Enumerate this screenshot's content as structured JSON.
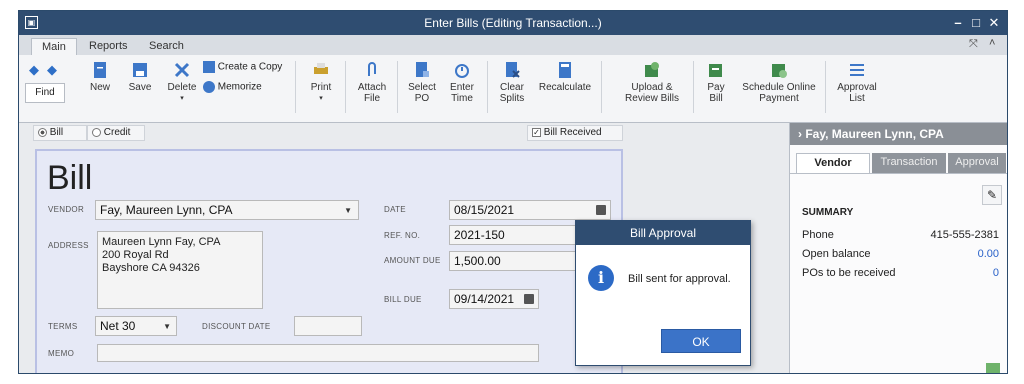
{
  "window": {
    "title": "Enter Bills (Editing Transaction...)"
  },
  "tabs": [
    "Main",
    "Reports",
    "Search"
  ],
  "toolbar": {
    "find": "Find",
    "new": "New",
    "save": "Save",
    "delete": "Delete",
    "create_copy": "Create a Copy",
    "memorize": "Memorize",
    "print": "Print",
    "attach_file": [
      "Attach",
      "File"
    ],
    "select_po": [
      "Select",
      "PO"
    ],
    "enter_time": [
      "Enter",
      "Time"
    ],
    "clear_splits": [
      "Clear",
      "Splits"
    ],
    "recalculate": "Recalculate",
    "upload_review": [
      "Upload &",
      "Review Bills"
    ],
    "pay_bill": [
      "Pay",
      "Bill"
    ],
    "schedule_payment": [
      "Schedule Online",
      "Payment"
    ],
    "approval_list": [
      "Approval",
      "List"
    ]
  },
  "form": {
    "bill_radio": "Bill",
    "credit_radio": "Credit",
    "bill_received": "Bill Received",
    "bill_heading": "Bill",
    "vendor_label": "VENDOR",
    "vendor_value": "Fay, Maureen Lynn, CPA",
    "address_label": "ADDRESS",
    "address_lines": [
      "Maureen Lynn Fay, CPA",
      "200 Royal Rd",
      "Bayshore CA 94326"
    ],
    "date_label": "DATE",
    "date_value": "08/15/2021",
    "ref_label": "REF. NO.",
    "ref_value": "2021-150",
    "amount_label": "AMOUNT DUE",
    "amount_value": "1,500.00",
    "billdue_label": "BILL DUE",
    "billdue_value": "09/14/2021",
    "terms_label": "TERMS",
    "terms_value": "Net 30",
    "discount_label": "DISCOUNT DATE",
    "memo_label": "MEMO"
  },
  "panel": {
    "vendor_name": "Fay, Maureen Lynn, CPA",
    "tabs": [
      "Vendor",
      "Transaction",
      "Approval"
    ],
    "summary_title": "SUMMARY",
    "rows": [
      {
        "label": "Phone",
        "value": "415-555-2381"
      },
      {
        "label": "Open balance",
        "value": "0.00"
      },
      {
        "label": "POs to be received",
        "value": "0"
      }
    ]
  },
  "dialog": {
    "title": "Bill Approval",
    "message": "Bill sent for approval.",
    "ok": "OK"
  },
  "colors": {
    "titlebar": "#2f4d71",
    "ok_button": "#3b73c8",
    "link_blue": "#2a62c9"
  }
}
